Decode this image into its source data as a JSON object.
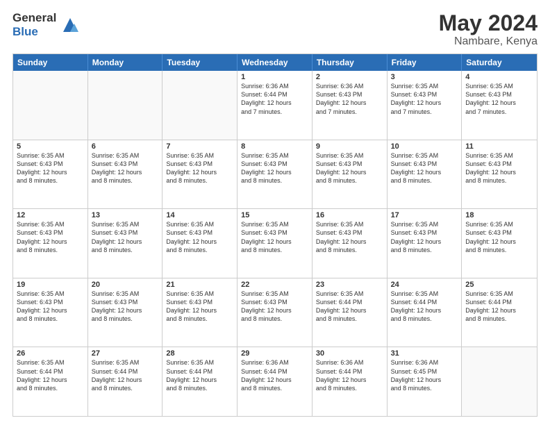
{
  "logo": {
    "general": "General",
    "blue": "Blue"
  },
  "title": {
    "month": "May 2024",
    "location": "Nambare, Kenya"
  },
  "header_days": [
    "Sunday",
    "Monday",
    "Tuesday",
    "Wednesday",
    "Thursday",
    "Friday",
    "Saturday"
  ],
  "weeks": [
    [
      {
        "day": "",
        "lines": []
      },
      {
        "day": "",
        "lines": []
      },
      {
        "day": "",
        "lines": []
      },
      {
        "day": "1",
        "lines": [
          "Sunrise: 6:36 AM",
          "Sunset: 6:44 PM",
          "Daylight: 12 hours",
          "and 7 minutes."
        ]
      },
      {
        "day": "2",
        "lines": [
          "Sunrise: 6:36 AM",
          "Sunset: 6:43 PM",
          "Daylight: 12 hours",
          "and 7 minutes."
        ]
      },
      {
        "day": "3",
        "lines": [
          "Sunrise: 6:35 AM",
          "Sunset: 6:43 PM",
          "Daylight: 12 hours",
          "and 7 minutes."
        ]
      },
      {
        "day": "4",
        "lines": [
          "Sunrise: 6:35 AM",
          "Sunset: 6:43 PM",
          "Daylight: 12 hours",
          "and 7 minutes."
        ]
      }
    ],
    [
      {
        "day": "5",
        "lines": [
          "Sunrise: 6:35 AM",
          "Sunset: 6:43 PM",
          "Daylight: 12 hours",
          "and 8 minutes."
        ]
      },
      {
        "day": "6",
        "lines": [
          "Sunrise: 6:35 AM",
          "Sunset: 6:43 PM",
          "Daylight: 12 hours",
          "and 8 minutes."
        ]
      },
      {
        "day": "7",
        "lines": [
          "Sunrise: 6:35 AM",
          "Sunset: 6:43 PM",
          "Daylight: 12 hours",
          "and 8 minutes."
        ]
      },
      {
        "day": "8",
        "lines": [
          "Sunrise: 6:35 AM",
          "Sunset: 6:43 PM",
          "Daylight: 12 hours",
          "and 8 minutes."
        ]
      },
      {
        "day": "9",
        "lines": [
          "Sunrise: 6:35 AM",
          "Sunset: 6:43 PM",
          "Daylight: 12 hours",
          "and 8 minutes."
        ]
      },
      {
        "day": "10",
        "lines": [
          "Sunrise: 6:35 AM",
          "Sunset: 6:43 PM",
          "Daylight: 12 hours",
          "and 8 minutes."
        ]
      },
      {
        "day": "11",
        "lines": [
          "Sunrise: 6:35 AM",
          "Sunset: 6:43 PM",
          "Daylight: 12 hours",
          "and 8 minutes."
        ]
      }
    ],
    [
      {
        "day": "12",
        "lines": [
          "Sunrise: 6:35 AM",
          "Sunset: 6:43 PM",
          "Daylight: 12 hours",
          "and 8 minutes."
        ]
      },
      {
        "day": "13",
        "lines": [
          "Sunrise: 6:35 AM",
          "Sunset: 6:43 PM",
          "Daylight: 12 hours",
          "and 8 minutes."
        ]
      },
      {
        "day": "14",
        "lines": [
          "Sunrise: 6:35 AM",
          "Sunset: 6:43 PM",
          "Daylight: 12 hours",
          "and 8 minutes."
        ]
      },
      {
        "day": "15",
        "lines": [
          "Sunrise: 6:35 AM",
          "Sunset: 6:43 PM",
          "Daylight: 12 hours",
          "and 8 minutes."
        ]
      },
      {
        "day": "16",
        "lines": [
          "Sunrise: 6:35 AM",
          "Sunset: 6:43 PM",
          "Daylight: 12 hours",
          "and 8 minutes."
        ]
      },
      {
        "day": "17",
        "lines": [
          "Sunrise: 6:35 AM",
          "Sunset: 6:43 PM",
          "Daylight: 12 hours",
          "and 8 minutes."
        ]
      },
      {
        "day": "18",
        "lines": [
          "Sunrise: 6:35 AM",
          "Sunset: 6:43 PM",
          "Daylight: 12 hours",
          "and 8 minutes."
        ]
      }
    ],
    [
      {
        "day": "19",
        "lines": [
          "Sunrise: 6:35 AM",
          "Sunset: 6:43 PM",
          "Daylight: 12 hours",
          "and 8 minutes."
        ]
      },
      {
        "day": "20",
        "lines": [
          "Sunrise: 6:35 AM",
          "Sunset: 6:43 PM",
          "Daylight: 12 hours",
          "and 8 minutes."
        ]
      },
      {
        "day": "21",
        "lines": [
          "Sunrise: 6:35 AM",
          "Sunset: 6:43 PM",
          "Daylight: 12 hours",
          "and 8 minutes."
        ]
      },
      {
        "day": "22",
        "lines": [
          "Sunrise: 6:35 AM",
          "Sunset: 6:43 PM",
          "Daylight: 12 hours",
          "and 8 minutes."
        ]
      },
      {
        "day": "23",
        "lines": [
          "Sunrise: 6:35 AM",
          "Sunset: 6:44 PM",
          "Daylight: 12 hours",
          "and 8 minutes."
        ]
      },
      {
        "day": "24",
        "lines": [
          "Sunrise: 6:35 AM",
          "Sunset: 6:44 PM",
          "Daylight: 12 hours",
          "and 8 minutes."
        ]
      },
      {
        "day": "25",
        "lines": [
          "Sunrise: 6:35 AM",
          "Sunset: 6:44 PM",
          "Daylight: 12 hours",
          "and 8 minutes."
        ]
      }
    ],
    [
      {
        "day": "26",
        "lines": [
          "Sunrise: 6:35 AM",
          "Sunset: 6:44 PM",
          "Daylight: 12 hours",
          "and 8 minutes."
        ]
      },
      {
        "day": "27",
        "lines": [
          "Sunrise: 6:35 AM",
          "Sunset: 6:44 PM",
          "Daylight: 12 hours",
          "and 8 minutes."
        ]
      },
      {
        "day": "28",
        "lines": [
          "Sunrise: 6:35 AM",
          "Sunset: 6:44 PM",
          "Daylight: 12 hours",
          "and 8 minutes."
        ]
      },
      {
        "day": "29",
        "lines": [
          "Sunrise: 6:36 AM",
          "Sunset: 6:44 PM",
          "Daylight: 12 hours",
          "and 8 minutes."
        ]
      },
      {
        "day": "30",
        "lines": [
          "Sunrise: 6:36 AM",
          "Sunset: 6:44 PM",
          "Daylight: 12 hours",
          "and 8 minutes."
        ]
      },
      {
        "day": "31",
        "lines": [
          "Sunrise: 6:36 AM",
          "Sunset: 6:45 PM",
          "Daylight: 12 hours",
          "and 8 minutes."
        ]
      },
      {
        "day": "",
        "lines": []
      }
    ]
  ],
  "colors": {
    "header_bg": "#2a6db5",
    "header_text": "#ffffff",
    "border": "#cccccc",
    "shaded": "#f0f0f0"
  }
}
